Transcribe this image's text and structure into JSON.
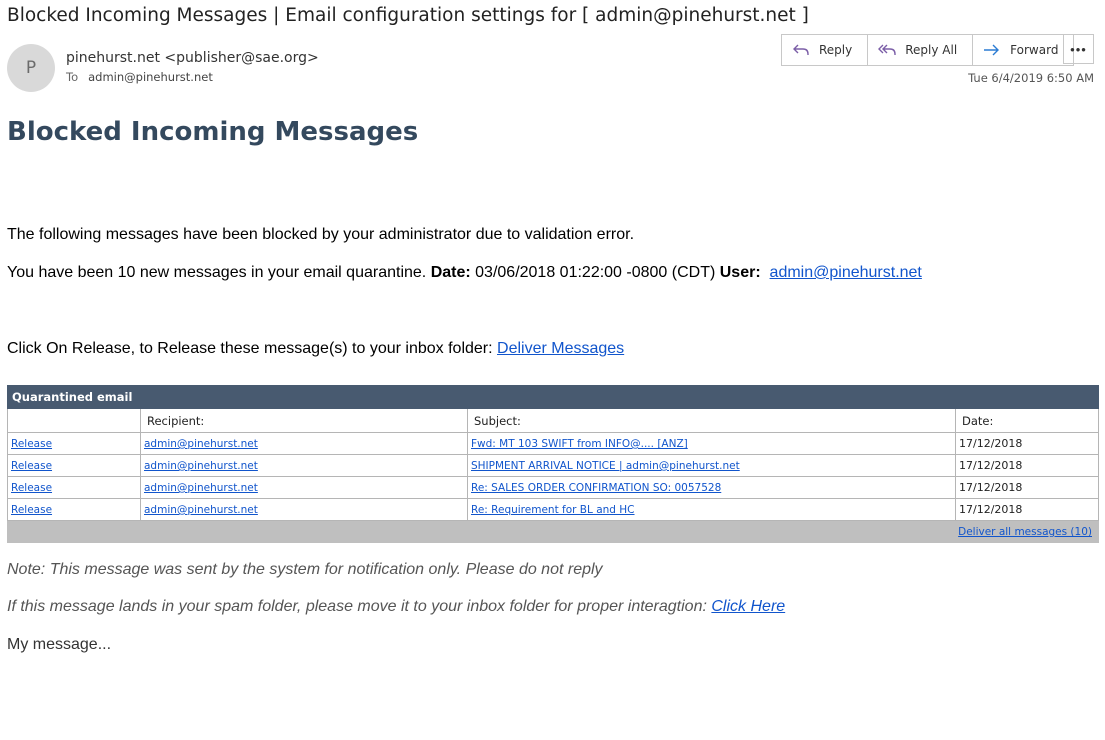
{
  "email": {
    "subject": "Blocked Incoming Messages | Email configuration settings for [ admin@pinehurst.net ]",
    "avatar_initial": "P",
    "sender": "pinehurst.net <publisher@sae.org>",
    "to_label": "To",
    "to_address": "admin@pinehurst.net",
    "datetime": "Tue 6/4/2019 6:50 AM"
  },
  "actions": [
    {
      "label": "Reply",
      "icon": "reply-icon"
    },
    {
      "label": "Reply All",
      "icon": "reply-all-icon"
    },
    {
      "label": "Forward",
      "icon": "forward-icon"
    }
  ],
  "more_label": "•••",
  "body": {
    "headline": "Blocked Incoming Messages",
    "line1": "The following messages have been blocked by your administrator due to validation error.",
    "line2_text": "You have been 10 new messages in your email quarantine. ",
    "date_label": "Date:",
    "date_value": " 03/06/2018 01:22:00 -0800 (CDT) ",
    "user_label": "User:",
    "user_link": "admin@pinehurst.net",
    "line3_text": "Click On Release, to Release these message(s) to your inbox folder:  ",
    "deliver_link": "Deliver Messages"
  },
  "table": {
    "title": "Quarantined email",
    "headers": [
      "",
      "Recipient:",
      "Subject:",
      "Date:"
    ],
    "rows": [
      {
        "action": "Release",
        "recipient": "admin@pinehurst.net",
        "subject": "Fwd: MT 103 SWIFT from INFO@.... [ANZ]",
        "date": "17/12/2018"
      },
      {
        "action": "Release",
        "recipient": "admin@pinehurst.net",
        "subject": "SHIPMENT ARRIVAL NOTICE | admin@pinehurst.net",
        "date": "17/12/2018"
      },
      {
        "action": "Release",
        "recipient": "admin@pinehurst.net",
        "subject": "Re: SALES ORDER CONFIRMATION SO: 0057528",
        "date": "17/12/2018"
      },
      {
        "action": "Release",
        "recipient": "admin@pinehurst.net",
        "subject": "Re: Requirement for BL and HC",
        "date": "17/12/2018"
      }
    ],
    "footer_link": "Deliver all messages (10)"
  },
  "notes": {
    "note1": "Note: This message was sent by the system for notification only.  Please do not reply",
    "note2_text": "If this message lands in your spam folder, please move it to your inbox folder for proper interagtion:   ",
    "click_here": "Click Here",
    "my_message": "My message..."
  },
  "colors": {
    "headline": "#34495e",
    "table_header": "#485a70",
    "link": "#1155cc",
    "footer_bar": "#bfbfbf",
    "action_icon": "#7b5ea7"
  }
}
